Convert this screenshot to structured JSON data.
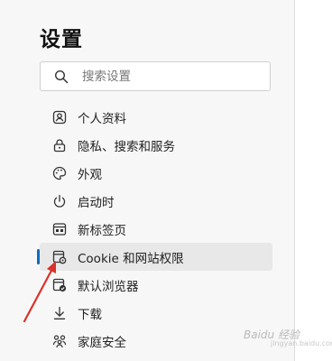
{
  "title": "设置",
  "search": {
    "placeholder": "搜索设置",
    "value": ""
  },
  "nav": {
    "items": [
      {
        "label": "个人资料",
        "icon": "profile-icon"
      },
      {
        "label": "隐私、搜索和服务",
        "icon": "lock-icon"
      },
      {
        "label": "外观",
        "icon": "palette-icon"
      },
      {
        "label": "启动时",
        "icon": "power-icon"
      },
      {
        "label": "新标签页",
        "icon": "new-tab-icon"
      },
      {
        "label": "Cookie 和网站权限",
        "icon": "site-permissions-icon",
        "active": true
      },
      {
        "label": "默认浏览器",
        "icon": "default-browser-icon"
      },
      {
        "label": "下载",
        "icon": "download-icon"
      },
      {
        "label": "家庭安全",
        "icon": "family-icon"
      }
    ]
  },
  "watermark": {
    "text": "Baidu 经验",
    "sub": "jingyan.baidu.com"
  },
  "colors": {
    "accent": "#0f6cbd",
    "arrow": "#d9322b",
    "active_bg": "#e8e8e8"
  }
}
